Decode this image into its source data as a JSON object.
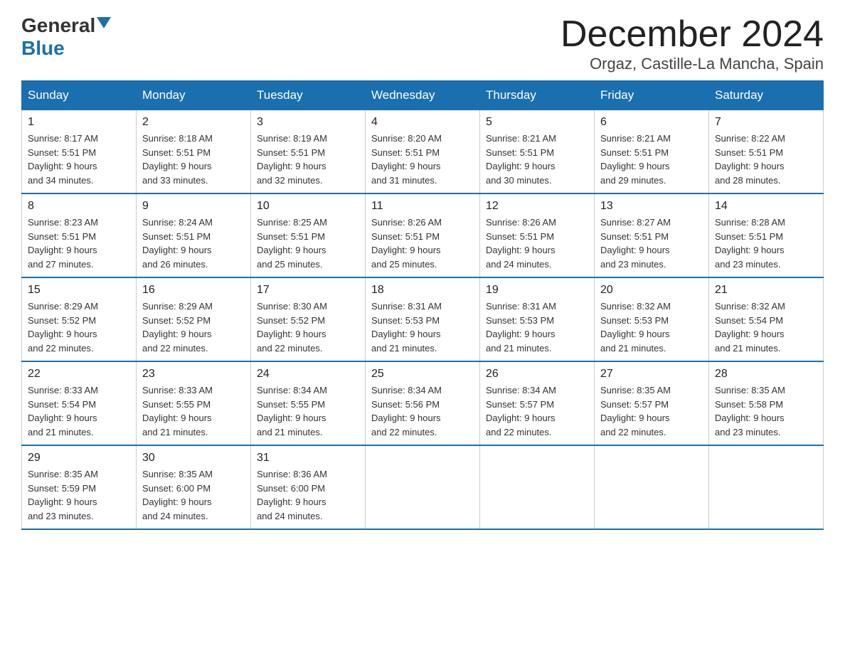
{
  "header": {
    "logo_general": "General",
    "logo_blue": "Blue",
    "month_title": "December 2024",
    "location": "Orgaz, Castille-La Mancha, Spain"
  },
  "days_of_week": [
    "Sunday",
    "Monday",
    "Tuesday",
    "Wednesday",
    "Thursday",
    "Friday",
    "Saturday"
  ],
  "weeks": [
    [
      {
        "day": "1",
        "info": "Sunrise: 8:17 AM\nSunset: 5:51 PM\nDaylight: 9 hours\nand 34 minutes."
      },
      {
        "day": "2",
        "info": "Sunrise: 8:18 AM\nSunset: 5:51 PM\nDaylight: 9 hours\nand 33 minutes."
      },
      {
        "day": "3",
        "info": "Sunrise: 8:19 AM\nSunset: 5:51 PM\nDaylight: 9 hours\nand 32 minutes."
      },
      {
        "day": "4",
        "info": "Sunrise: 8:20 AM\nSunset: 5:51 PM\nDaylight: 9 hours\nand 31 minutes."
      },
      {
        "day": "5",
        "info": "Sunrise: 8:21 AM\nSunset: 5:51 PM\nDaylight: 9 hours\nand 30 minutes."
      },
      {
        "day": "6",
        "info": "Sunrise: 8:21 AM\nSunset: 5:51 PM\nDaylight: 9 hours\nand 29 minutes."
      },
      {
        "day": "7",
        "info": "Sunrise: 8:22 AM\nSunset: 5:51 PM\nDaylight: 9 hours\nand 28 minutes."
      }
    ],
    [
      {
        "day": "8",
        "info": "Sunrise: 8:23 AM\nSunset: 5:51 PM\nDaylight: 9 hours\nand 27 minutes."
      },
      {
        "day": "9",
        "info": "Sunrise: 8:24 AM\nSunset: 5:51 PM\nDaylight: 9 hours\nand 26 minutes."
      },
      {
        "day": "10",
        "info": "Sunrise: 8:25 AM\nSunset: 5:51 PM\nDaylight: 9 hours\nand 25 minutes."
      },
      {
        "day": "11",
        "info": "Sunrise: 8:26 AM\nSunset: 5:51 PM\nDaylight: 9 hours\nand 25 minutes."
      },
      {
        "day": "12",
        "info": "Sunrise: 8:26 AM\nSunset: 5:51 PM\nDaylight: 9 hours\nand 24 minutes."
      },
      {
        "day": "13",
        "info": "Sunrise: 8:27 AM\nSunset: 5:51 PM\nDaylight: 9 hours\nand 23 minutes."
      },
      {
        "day": "14",
        "info": "Sunrise: 8:28 AM\nSunset: 5:51 PM\nDaylight: 9 hours\nand 23 minutes."
      }
    ],
    [
      {
        "day": "15",
        "info": "Sunrise: 8:29 AM\nSunset: 5:52 PM\nDaylight: 9 hours\nand 22 minutes."
      },
      {
        "day": "16",
        "info": "Sunrise: 8:29 AM\nSunset: 5:52 PM\nDaylight: 9 hours\nand 22 minutes."
      },
      {
        "day": "17",
        "info": "Sunrise: 8:30 AM\nSunset: 5:52 PM\nDaylight: 9 hours\nand 22 minutes."
      },
      {
        "day": "18",
        "info": "Sunrise: 8:31 AM\nSunset: 5:53 PM\nDaylight: 9 hours\nand 21 minutes."
      },
      {
        "day": "19",
        "info": "Sunrise: 8:31 AM\nSunset: 5:53 PM\nDaylight: 9 hours\nand 21 minutes."
      },
      {
        "day": "20",
        "info": "Sunrise: 8:32 AM\nSunset: 5:53 PM\nDaylight: 9 hours\nand 21 minutes."
      },
      {
        "day": "21",
        "info": "Sunrise: 8:32 AM\nSunset: 5:54 PM\nDaylight: 9 hours\nand 21 minutes."
      }
    ],
    [
      {
        "day": "22",
        "info": "Sunrise: 8:33 AM\nSunset: 5:54 PM\nDaylight: 9 hours\nand 21 minutes."
      },
      {
        "day": "23",
        "info": "Sunrise: 8:33 AM\nSunset: 5:55 PM\nDaylight: 9 hours\nand 21 minutes."
      },
      {
        "day": "24",
        "info": "Sunrise: 8:34 AM\nSunset: 5:55 PM\nDaylight: 9 hours\nand 21 minutes."
      },
      {
        "day": "25",
        "info": "Sunrise: 8:34 AM\nSunset: 5:56 PM\nDaylight: 9 hours\nand 22 minutes."
      },
      {
        "day": "26",
        "info": "Sunrise: 8:34 AM\nSunset: 5:57 PM\nDaylight: 9 hours\nand 22 minutes."
      },
      {
        "day": "27",
        "info": "Sunrise: 8:35 AM\nSunset: 5:57 PM\nDaylight: 9 hours\nand 22 minutes."
      },
      {
        "day": "28",
        "info": "Sunrise: 8:35 AM\nSunset: 5:58 PM\nDaylight: 9 hours\nand 23 minutes."
      }
    ],
    [
      {
        "day": "29",
        "info": "Sunrise: 8:35 AM\nSunset: 5:59 PM\nDaylight: 9 hours\nand 23 minutes."
      },
      {
        "day": "30",
        "info": "Sunrise: 8:35 AM\nSunset: 6:00 PM\nDaylight: 9 hours\nand 24 minutes."
      },
      {
        "day": "31",
        "info": "Sunrise: 8:36 AM\nSunset: 6:00 PM\nDaylight: 9 hours\nand 24 minutes."
      },
      {
        "day": "",
        "info": ""
      },
      {
        "day": "",
        "info": ""
      },
      {
        "day": "",
        "info": ""
      },
      {
        "day": "",
        "info": ""
      }
    ]
  ]
}
